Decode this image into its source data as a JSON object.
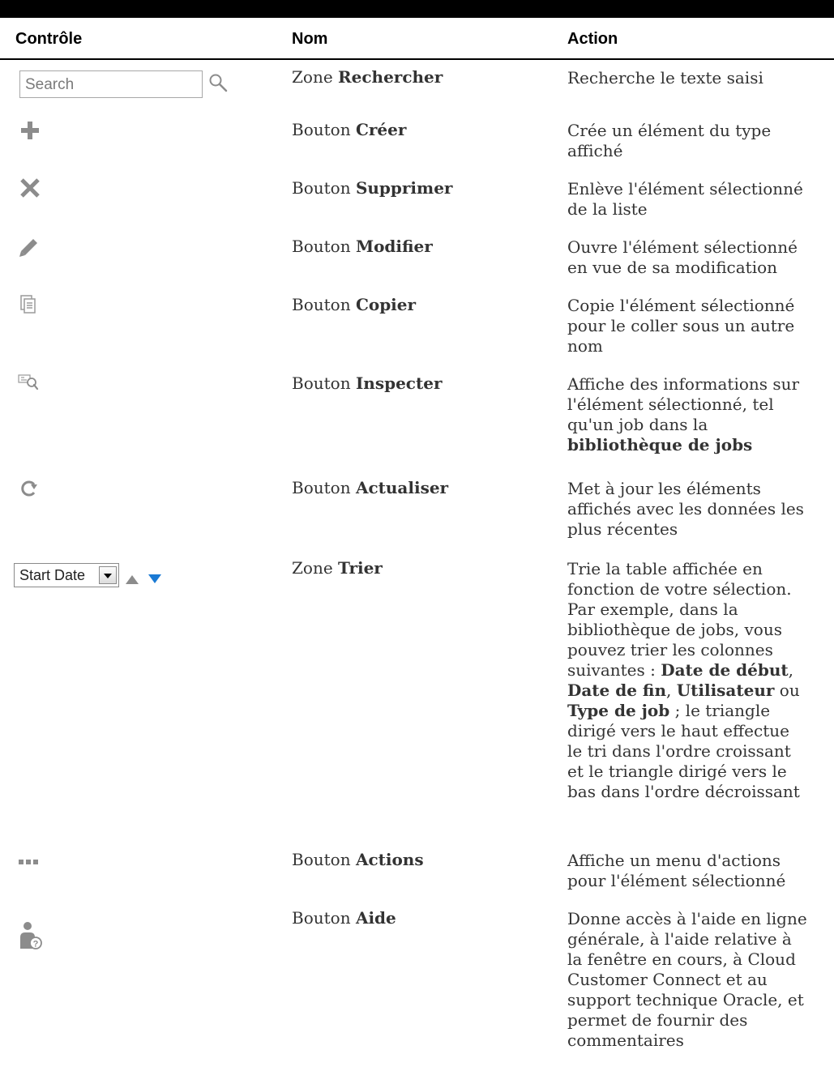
{
  "headers": {
    "control": "Contrôle",
    "name": "Nom",
    "action": "Action"
  },
  "search": {
    "placeholder": "Search"
  },
  "sort": {
    "selected": "Start Date"
  },
  "colors": {
    "icon_gray": "#8c8c8c",
    "sort_up": "#8c8c8c",
    "sort_down": "#1a7ad4"
  },
  "rows": [
    {
      "name_prefix": "Zone",
      "name_bold": "Rechercher",
      "action": [
        "Recherche le texte saisi"
      ]
    },
    {
      "name_prefix": "Bouton",
      "name_bold": "Créer",
      "action": [
        "Crée un élément du type",
        "affiché"
      ]
    },
    {
      "name_prefix": "Bouton",
      "name_bold": "Supprimer",
      "action": [
        "Enlève l'élément sélectionné",
        "de la liste"
      ]
    },
    {
      "name_prefix": "Bouton",
      "name_bold": "Modifier",
      "action": [
        "Ouvre l'élément sélectionné",
        "en vue de sa modification"
      ]
    },
    {
      "name_prefix": "Bouton",
      "name_bold": "Copier",
      "action": [
        "Copie l'élément sélectionné",
        "pour le coller sous un autre",
        "nom"
      ]
    },
    {
      "name_prefix": "Bouton",
      "name_bold": "Inspecter",
      "action": [
        "Affiche des informations sur",
        "l'élément sélectionné, tel",
        "qu'un job dans la"
      ],
      "action_bold_line": "bibliothèque de jobs"
    },
    {
      "name_prefix": "Bouton",
      "name_bold": "Actualiser",
      "action": [
        "Met à jour les éléments",
        "affichés avec les données les",
        "plus récentes"
      ]
    },
    {
      "name_prefix": "Zone",
      "name_bold": "Trier",
      "action_lines": [
        [
          "Trie la table affichée en"
        ],
        [
          "fonction de votre sélection."
        ],
        [
          "Par exemple, dans la"
        ],
        [
          "bibliothèque de jobs, vous"
        ],
        [
          "pouvez trier les colonnes"
        ],
        [
          "suivantes : ",
          "*Date de début",
          ","
        ],
        [
          "*Date de fin",
          ", ",
          "*Utilisateur",
          " ou"
        ],
        [
          "*Type de job",
          " ; le triangle"
        ],
        [
          "dirigé vers le haut effectue"
        ],
        [
          "le tri dans l'ordre croissant"
        ],
        [
          "et le triangle dirigé vers le"
        ],
        [
          "bas dans l'ordre décroissant"
        ]
      ]
    },
    {
      "name_prefix": "Bouton",
      "name_bold": "Actions",
      "action": [
        "Affiche un menu d'actions",
        "pour l'élément sélectionné"
      ]
    },
    {
      "name_prefix": "Bouton",
      "name_bold": "Aide",
      "action": [
        "Donne accès à l'aide en ligne",
        "générale, à l'aide relative à",
        "la fenêtre en cours, à Cloud",
        "Customer Connect et au",
        "support technique Oracle, et",
        "permet de fournir des",
        "commentaires"
      ]
    }
  ]
}
